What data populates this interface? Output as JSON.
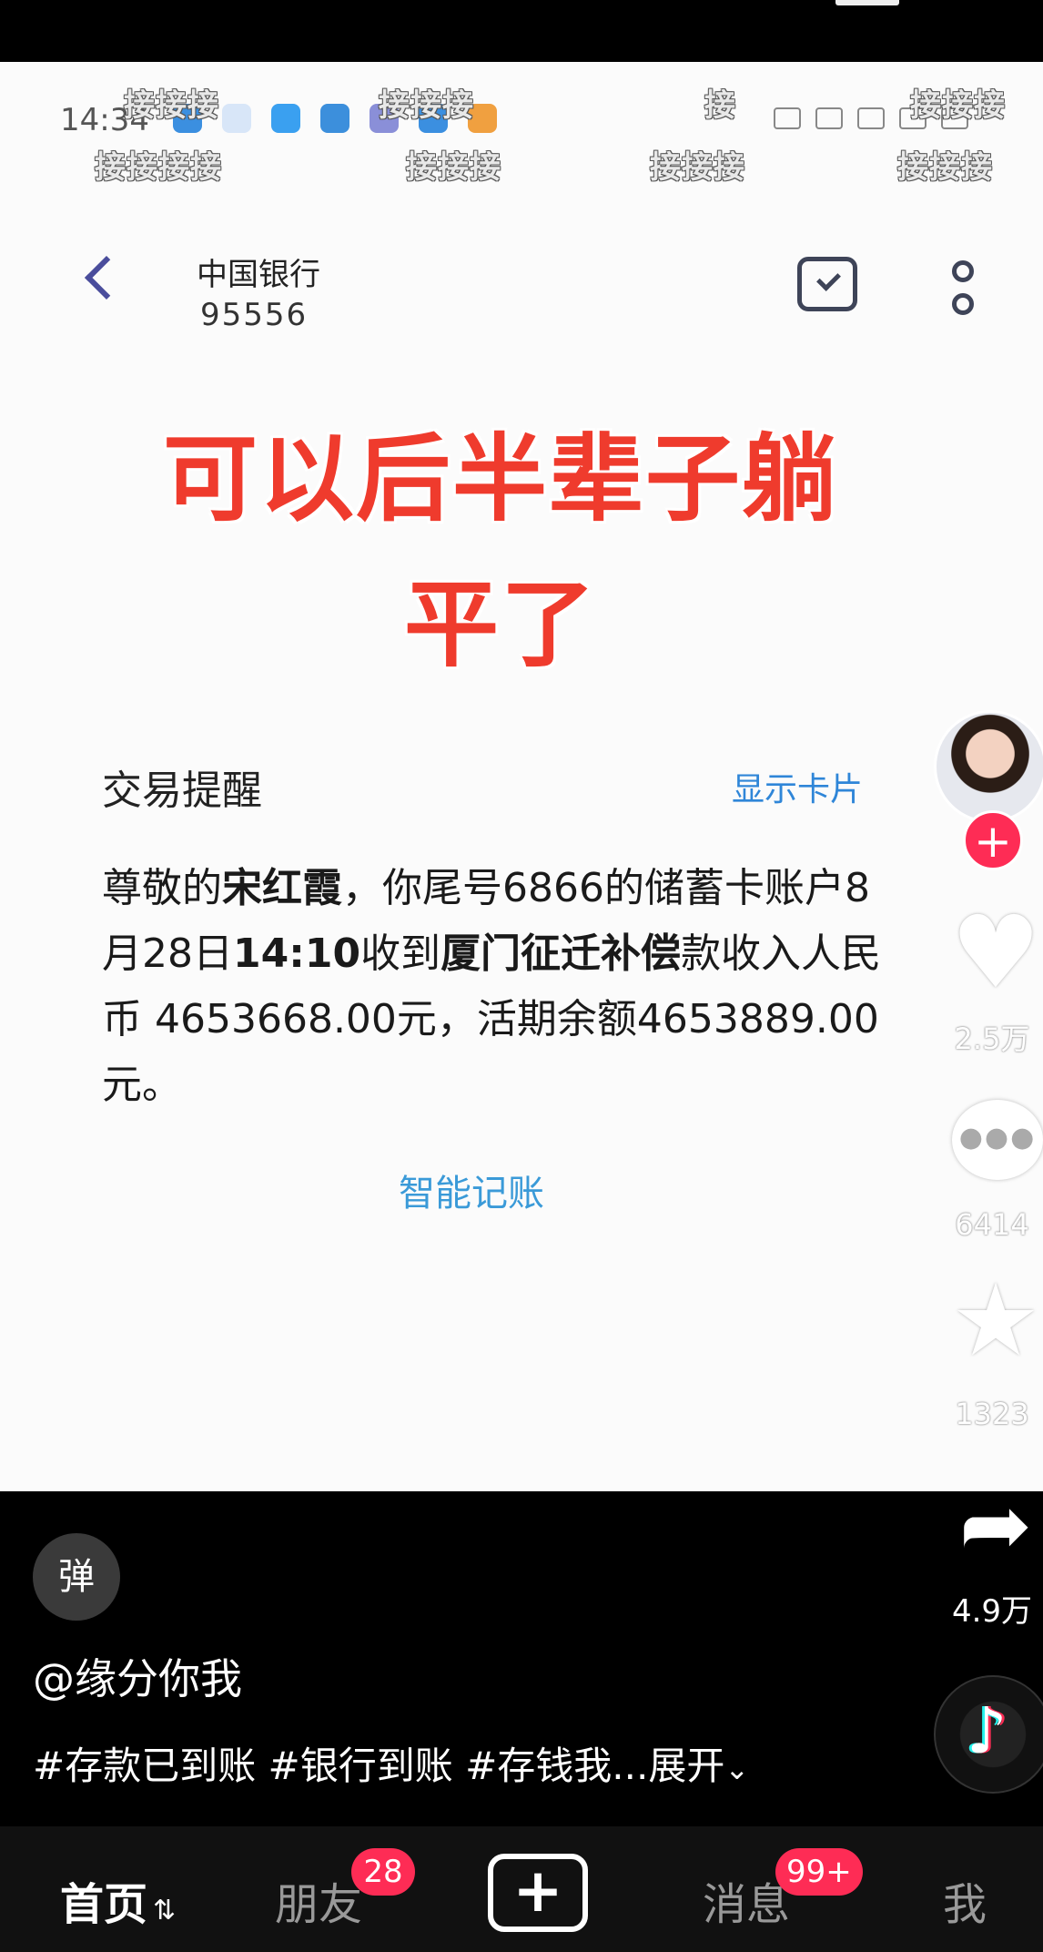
{
  "status_bar": {
    "time": "14:34"
  },
  "watermarks": [
    "接接接",
    "接接接",
    "接",
    "接接接",
    "接接接接",
    "接接接",
    "接接接",
    "接接接"
  ],
  "sms_header": {
    "sender_name": "中国银行",
    "sender_number": "95556"
  },
  "overlay_title": {
    "line1": "可以后半辈子躺",
    "line2": "平了"
  },
  "message": {
    "title": "交易提醒",
    "show_card": "显示卡片",
    "p1": "尊敬的",
    "name": "宋红霞",
    "p2": "，你尾号6866的储蓄卡账户8月28日",
    "time": "14:10",
    "p3": "收到",
    "payer": "厦门征迁补偿",
    "p4": "款收入人民币 4653668.00元，活期余额4653889.00 元。",
    "smart_account": "智能记账"
  },
  "side_actions": {
    "likes": "2.5万",
    "comments": "6414",
    "favorites": "1323",
    "shares": "4.9万"
  },
  "danmu_label": "弹",
  "author": "@缘分你我",
  "hashtags": "#存款已到账 #银行到账 #存钱我...",
  "expand_label": "展开",
  "bottom_nav": {
    "home": "首页",
    "friends": "朋友",
    "friends_badge": "28",
    "messages": "消息",
    "messages_badge": "99+",
    "me": "我"
  },
  "colors": {
    "accent": "#fe2c55",
    "title_red": "#ef3b2d",
    "link_blue": "#2f86d8"
  }
}
